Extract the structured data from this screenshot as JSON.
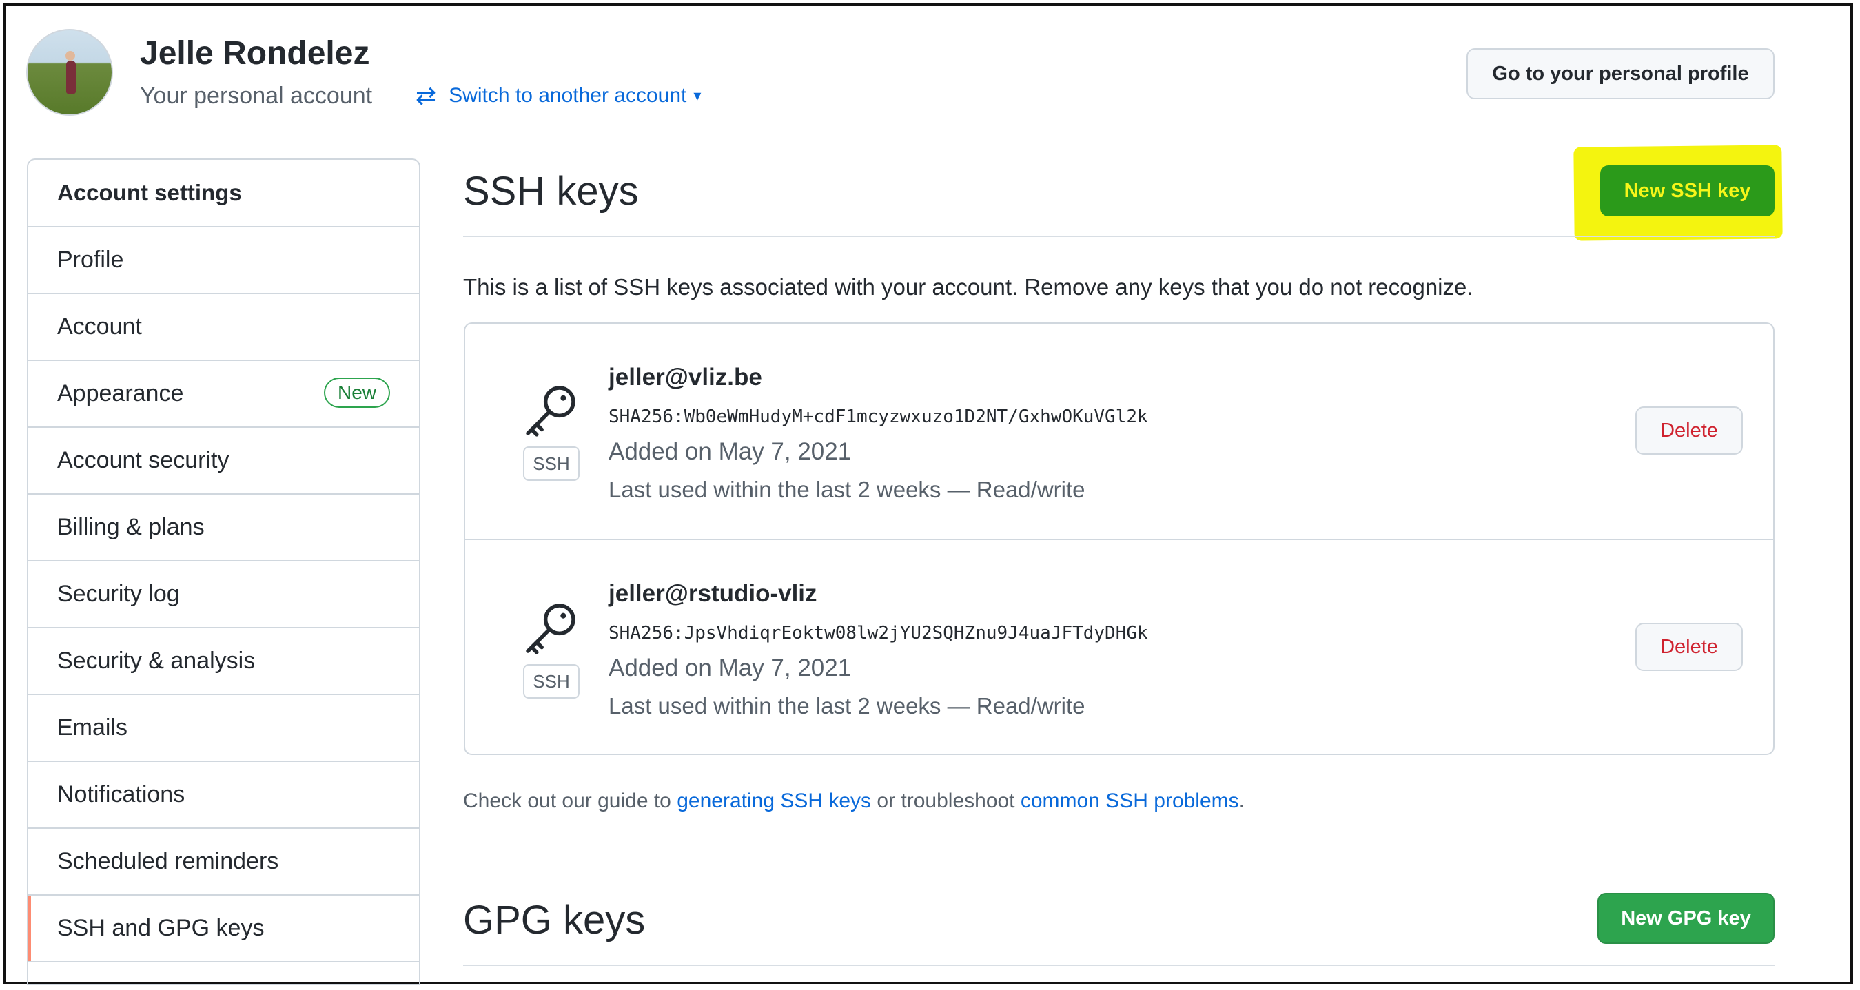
{
  "header": {
    "user_name": "Jelle Rondelez",
    "account_type": "Your personal account",
    "switch_account_label": "Switch to another account",
    "profile_button": "Go to your personal profile"
  },
  "sidebar": {
    "title": "Account settings",
    "items": [
      {
        "label": "Profile"
      },
      {
        "label": "Account"
      },
      {
        "label": "Appearance",
        "badge": "New"
      },
      {
        "label": "Account security"
      },
      {
        "label": "Billing & plans"
      },
      {
        "label": "Security log"
      },
      {
        "label": "Security & analysis"
      },
      {
        "label": "Emails"
      },
      {
        "label": "Notifications"
      },
      {
        "label": "Scheduled reminders"
      },
      {
        "label": "SSH and GPG keys",
        "selected": true
      }
    ]
  },
  "ssh": {
    "title": "SSH keys",
    "new_button": "New SSH key",
    "description": "This is a list of SSH keys associated with your account. Remove any keys that you do not recognize.",
    "keys": [
      {
        "name": "jeller@vliz.be",
        "fingerprint": "SHA256:Wb0eWmHudyM+cdF1mcyzwxuzo1D2NT/GxhwOKuVGl2k",
        "added": "Added on May 7, 2021",
        "last_used": "Last used within the last 2 weeks — Read/write",
        "type_label": "SSH",
        "delete_label": "Delete"
      },
      {
        "name": "jeller@rstudio-vliz",
        "fingerprint": "SHA256:JpsVhdiqrEoktw08lw2jYU2SQHZnu9J4uaJFTdyDHGk",
        "added": "Added on May 7, 2021",
        "last_used": "Last used within the last 2 weeks — Read/write",
        "type_label": "SSH",
        "delete_label": "Delete"
      }
    ],
    "guide_prefix": "Check out our guide to",
    "guide_link1": "generating SSH keys",
    "guide_middle": "or troubleshoot",
    "guide_link2": "common SSH problems",
    "guide_suffix": "."
  },
  "gpg": {
    "title": "GPG keys",
    "new_button": "New GPG key"
  },
  "colors": {
    "accent_link": "#0969da",
    "green_button": "#2da44e",
    "highlight": "#f4f40f",
    "delete_red": "#cf222e",
    "selected_marker": "#fd8c73"
  },
  "icons": [
    "arrow-switch-icon",
    "chevron-down-icon",
    "key-icon"
  ]
}
